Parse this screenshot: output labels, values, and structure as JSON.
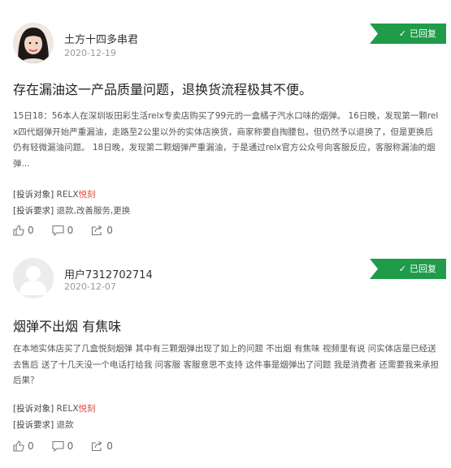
{
  "posts": [
    {
      "username": "土方十四多串君",
      "date": "2020-12-19",
      "badge": "已回复",
      "title": "存在漏油这一产品质量问题，退换货流程极其不便。",
      "body": "15日18：56本人在深圳坂田彩生活relx专卖店购买了99元的一盒橘子汽水口味的烟弹。 16日晚，发现第一颗relx四代烟弹开始严重漏油，走路至2公里以外的实体店换货，商家称要自掏腰包，但仍然予以退换了，但是更换后仍有轻微漏油问题。 18日晚，发现第二颗烟弹严重漏油，于是通过relx官方公众号向客服反应，客服称漏油的烟弹...",
      "target_label": "[投诉对象]",
      "target_value": "RELX",
      "target_suffix": "悦刻",
      "demand_label": "[投诉要求]",
      "demand_value": "退款,改善服务,更换",
      "likes": "0",
      "comments": "0",
      "shares": "0"
    },
    {
      "username": "用户7312702714",
      "date": "2020-12-07",
      "badge": "已回复",
      "title": "烟弹不出烟 有焦味",
      "body": "在本地实体店买了几盒悦刻烟弹 其中有三颗烟弹出现了如上的问题 不出烟 有焦味 视频里有说 问实体店是已经送去售后 送了十几天没一个电话打给我 问客服 客服意思不支持 这件事是烟弹出了问题 我是消费者 还需要我来承担后果？",
      "target_label": "[投诉对象]",
      "target_value": "RELX",
      "target_suffix": "悦刻",
      "demand_label": "[投诉要求]",
      "demand_value": "退款",
      "likes": "0",
      "comments": "0",
      "shares": "0"
    }
  ],
  "icons": {
    "like": "thumbs-up-icon",
    "comment": "comment-icon",
    "share": "share-icon",
    "check": "check-icon"
  },
  "colors": {
    "badge_green": "#1f9b4a",
    "brand_red": "#e0453b"
  }
}
